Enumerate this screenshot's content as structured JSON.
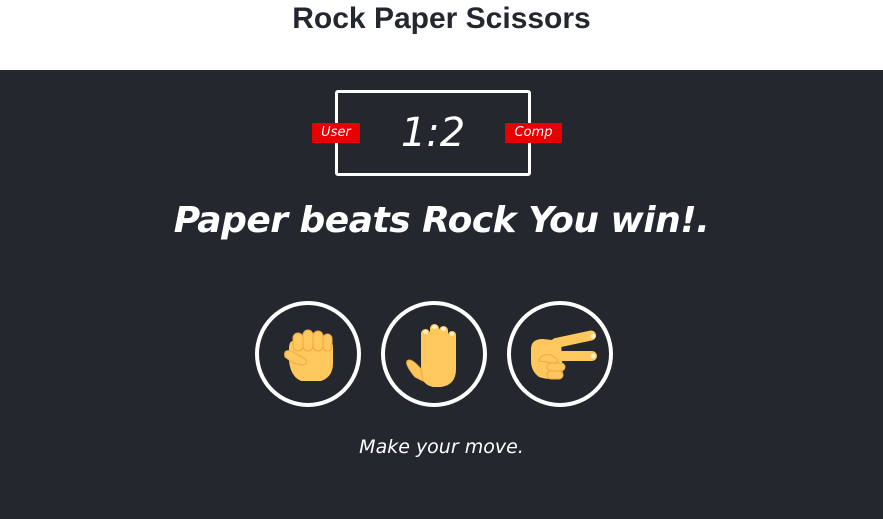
{
  "app": {
    "title": "Rock Paper Scissors"
  },
  "scoreboard": {
    "user_label": "User",
    "comp_label": "Comp",
    "score": "1:2"
  },
  "result": {
    "message": "Paper beats Rock You win!."
  },
  "choices": [
    {
      "id": "rock",
      "icon": "raised-fist-icon"
    },
    {
      "id": "paper",
      "icon": "raised-hand-icon"
    },
    {
      "id": "scissors",
      "icon": "victory-hand-icon"
    }
  ],
  "prompt": {
    "text": "Make your move."
  },
  "colors": {
    "background": "#24272e",
    "badge": "#e60000",
    "text": "#ffffff",
    "hand": "#ffc85c",
    "hand_shade": "#eea84a"
  }
}
